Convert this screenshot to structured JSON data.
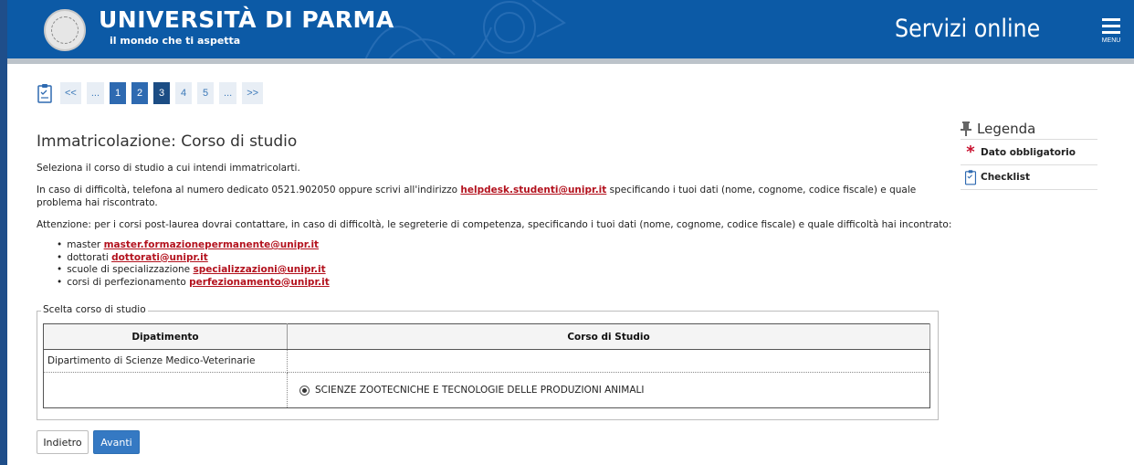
{
  "header": {
    "university_name": "UNIVERSITÀ DI PARMA",
    "tagline": "il mondo che ti aspetta",
    "service_title": "Servizi online",
    "menu_label": "MENU",
    "brand_color": "#0c5aa6"
  },
  "stepper": {
    "icon": "checklist-clipboard-icon",
    "steps": [
      "<<",
      "...",
      "1",
      "2",
      "3",
      "4",
      "5",
      "...",
      ">>"
    ],
    "current_step": "3"
  },
  "page": {
    "title": "Immatricolazione: Corso di studio",
    "intro": "Seleziona il corso di studio a cui intendi immatricolarti.",
    "help_before": "In caso di difficoltà, telefona al numero dedicato 0521.902050 oppure scrivi all'indirizzo ",
    "help_email": "helpdesk.studenti@unipr.it",
    "help_after": " specificando i tuoi dati (nome, cognome, codice fiscale) e quale problema hai riscontrato.",
    "attention": "Attenzione: per i corsi post-laurea dovrai contattare, in caso di difficoltà, le segreterie di competenza, specificando i tuoi dati (nome, cognome, codice fiscale) e quale difficoltà hai incontrato:",
    "contacts": [
      {
        "label": "master ",
        "email": "master.formazionepermanente@unipr.it"
      },
      {
        "label": "dottorati ",
        "email": "dottorati@unipr.it"
      },
      {
        "label": "scuole di specializzazione ",
        "email": "specializzazioni@unipr.it"
      },
      {
        "label": "corsi di perfezionamento ",
        "email": "perfezionamento@unipr.it"
      }
    ]
  },
  "selection": {
    "legend": "Scelta corso di studio",
    "columns": [
      "Dipatimento",
      "Corso di Studio"
    ],
    "department": "Dipartimento di Scienze Medico-Veterinarie",
    "course": "SCIENZE ZOOTECNICHE E TECNOLOGIE DELLE PRODUZIONI ANIMALI",
    "course_selected": true
  },
  "actions": {
    "back_label": "Indietro",
    "next_label": "Avanti"
  },
  "legend_panel": {
    "title": "Legenda",
    "items": [
      {
        "icon": "required-star-icon",
        "label": "Dato obbligatorio"
      },
      {
        "icon": "checklist-clipboard-icon",
        "label": "Checklist"
      }
    ]
  }
}
